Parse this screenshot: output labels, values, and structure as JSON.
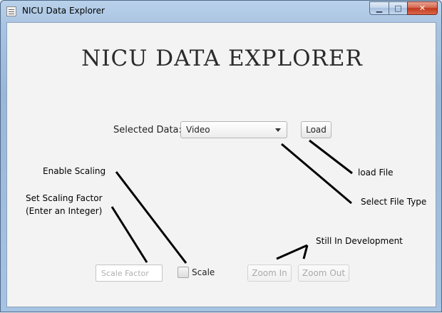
{
  "window": {
    "title": "NICU Data Explorer",
    "controls": {
      "minimize": "▁",
      "maximize": "□",
      "close": "✕"
    }
  },
  "main": {
    "heading": "NICU DATA EXPLORER",
    "data_select": {
      "label": "Selected Data:",
      "value": "Video"
    },
    "load_button": "Load",
    "scale_input_placeholder": "Scale Factor",
    "scale_checkbox_label": "Scale",
    "zoom_in_button": "Zoom In",
    "zoom_out_button": "Zoom Out"
  },
  "annotations": {
    "enable_scaling": "Enable Scaling",
    "set_scaling_factor_line1": "Set Scaling Factor",
    "set_scaling_factor_line2": "(Enter an Integer)",
    "load_file": "load File",
    "select_file_type": "Select File Type",
    "still_in_development": "Still In Development"
  }
}
